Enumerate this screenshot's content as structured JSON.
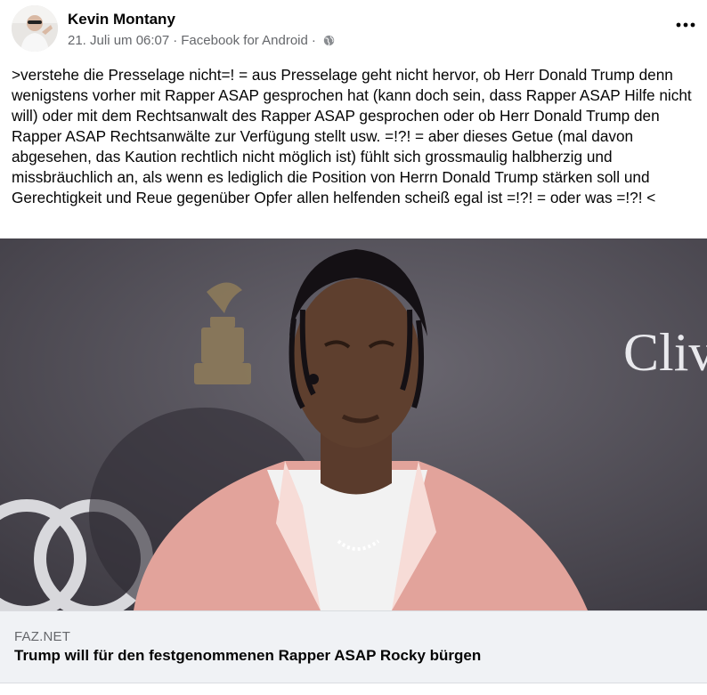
{
  "post": {
    "author_name": "Kevin Montany",
    "timestamp": "21. Juli um 06:07",
    "separator_1": "·",
    "source_app": "Facebook for Android",
    "separator_2": "·",
    "privacy_icon": "globe-icon",
    "more_icon": "more-options-icon",
    "body_text": ">verstehe die Presselage nicht=! = aus Presselage geht nicht hervor, ob Herr Donald Trump denn wenigstens vorher mit Rapper ASAP gesprochen hat (kann doch sein, dass Rapper ASAP Hilfe nicht will) oder mit dem Rechtsanwalt des Rapper ASAP gesprochen oder ob Herr Donald Trump den Rapper ASAP Rechtsanwälte zur Verfügung stellt usw. =!?! = aber dieses Getue (mal davon abgesehen, das Kaution rechtlich nicht möglich ist) fühlt sich grossmaulig halbherzig und missbräuchlich an, als wenn es lediglich die Position von Herrn Donald Trump stärken soll und Gerechtigkeit und Reue gegenüber Opfer allen helfenden scheiß egal ist =!?! = oder was =!?! <"
  },
  "photo": {
    "backdrop_text": "Cliv"
  },
  "link_preview": {
    "domain": "FAZ.NET",
    "headline": "Trump will für den festgenommenen Rapper ASAP Rocky bürgen"
  },
  "colors": {
    "text_primary": "#050505",
    "text_secondary": "#65676b",
    "link_bar_bg": "#f0f2f5",
    "jacket_pink": "#e8a7a0"
  }
}
